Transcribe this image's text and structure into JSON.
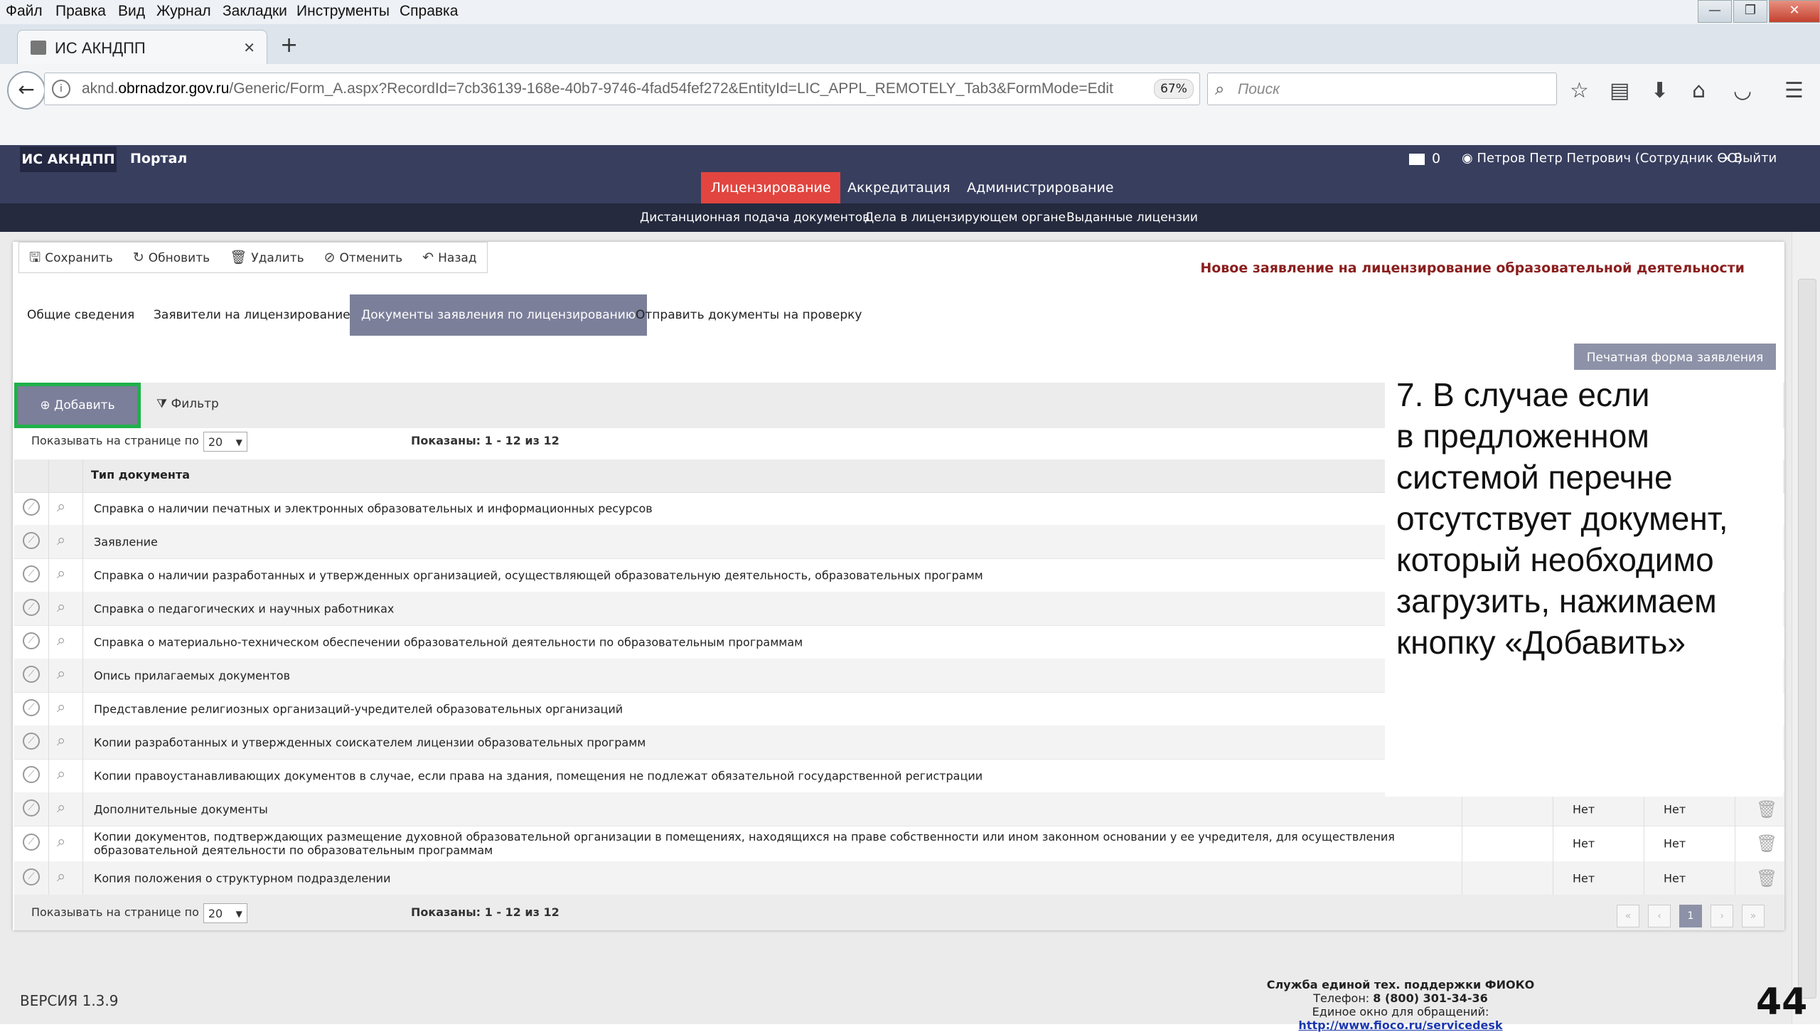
{
  "browser": {
    "menu": [
      "Файл",
      "Правка",
      "Вид",
      "Журнал",
      "Закладки",
      "Инструменты",
      "Справка"
    ],
    "tab_title": "ИС АКНДПП",
    "url_prefix": "aknd.",
    "url_domain": "obrnadzor.gov.ru",
    "url_path": "/Generic/Form_A.aspx?RecordId=7cb36139-168e-40b7-9746-4fad54fef272&EntityId=LIC_APPL_REMOTELY_Tab3&FormMode=Edit",
    "zoom": "67%",
    "search_placeholder": "Поиск"
  },
  "app": {
    "brand": "ИС АКНДПП",
    "portal": "Портал",
    "mail_count": "0",
    "user": "Петров Петр Петрович (Сотрудник ОО)",
    "logout": "Выйти",
    "main_nav": [
      "Лицензирование",
      "Аккредитация",
      "Администрирование"
    ],
    "sub_nav": [
      "Дистанционная подача документов",
      "Дела в лицензирующем органе",
      "Выданные лицензии"
    ]
  },
  "toolbar": {
    "save": "Сохранить",
    "refresh": "Обновить",
    "delete": "Удалить",
    "cancel": "Отменить",
    "back": "Назад"
  },
  "form": {
    "title": "Новое заявление на лицензирование образовательной деятельности",
    "tabs": [
      "Общие сведения",
      "Заявители на лицензирование",
      "Документы заявления по лицензированию",
      "Отправить документы на проверку"
    ],
    "print_button": "Печатная форма заявления"
  },
  "grid": {
    "add_button": "Добавить",
    "filter_button": "Фильтр",
    "per_page_label": "Показывать на странице по",
    "per_page_value": "20",
    "shown": "Показаны: 1 - 12 из 12",
    "column": "Тип документа",
    "rows": [
      {
        "name": "Справка о наличии печатных и электронных образовательных и информационных ресурсов",
        "c1": "",
        "c2": ""
      },
      {
        "name": "Заявление",
        "c1": "",
        "c2": ""
      },
      {
        "name": "Справка о наличии разработанных и утвержденных организацией, осуществляющей образовательную деятельность, образовательных программ",
        "c1": "",
        "c2": ""
      },
      {
        "name": "Справка о педагогических и научных работниках",
        "c1": "",
        "c2": ""
      },
      {
        "name": "Справка о материально-техническом обеспечении образовательной деятельности по образовательным программам",
        "c1": "",
        "c2": ""
      },
      {
        "name": "Опись прилагаемых документов",
        "c1": "",
        "c2": ""
      },
      {
        "name": "Представление религиозных организаций-учредителей образовательных организаций",
        "c1": "",
        "c2": ""
      },
      {
        "name": "Копии разработанных и утвержденных соискателем лицензии образовательных программ",
        "c1": "",
        "c2": ""
      },
      {
        "name": "Копии правоустанавливающих документов в случае, если права на здания, помещения не подлежат обязательной государственной регистрации",
        "c1": "",
        "c2": ""
      },
      {
        "name": "Дополнительные документы",
        "c1": "Нет",
        "c2": "Нет"
      },
      {
        "name": "Копии документов, подтверждающих размещение духовной образовательной организации в помещениях, находящихся на праве собственности или ином законном основании у ее учредителя, для осуществления образовательной деятельности по образовательным программам",
        "c1": "Нет",
        "c2": "Нет"
      },
      {
        "name": "Копия положения о структурном подразделении",
        "c1": "Нет",
        "c2": "Нет"
      }
    ],
    "pager_current": "1"
  },
  "annotation": "7. В случае если\nв предложенном\nсистемой перечне\nотсутствует документ,\nкоторый необходимо\nзагрузить, нажимаем\nкнопку «Добавить»",
  "footer": {
    "version": "ВЕРСИЯ 1.3.9",
    "support_title": "Служба единой тех. поддержки ФИОКО",
    "support_phone_label": "Телефон: ",
    "support_phone": "8 (800) 301-34-36",
    "support_window_label": "Единое окно для обращений: ",
    "support_link": "http://www.fioco.ru/servicedesk",
    "slide_number": "44"
  },
  "colors": {
    "header_bg": "#383e5e",
    "active_nav": "#e2453f",
    "active_tab": "#7b7f99",
    "add_highlight": "#1fb04a",
    "title_red": "#8a1e1e"
  }
}
